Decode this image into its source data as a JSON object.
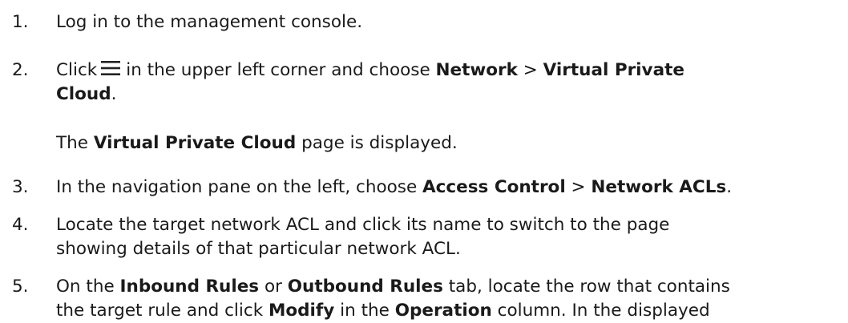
{
  "steps": [
    {
      "number": "1.",
      "text": "Log in to the management console."
    },
    {
      "number": "2.",
      "click": "Click",
      "icon": "menu-icon",
      "mid": "in the upper left corner and choose",
      "b1": "Network",
      "sep": ">",
      "b2": "Virtual Private",
      "b3": "Cloud",
      "end": "."
    },
    {
      "result_prefix": "The",
      "result_bold": "Virtual Private Cloud",
      "result_suffix": "page is displayed."
    },
    {
      "number": "3.",
      "pre": "In the navigation pane on the left, choose",
      "b1": "Access Control",
      "sep": ">",
      "b2": "Network ACLs",
      "end": "."
    },
    {
      "number": "4.",
      "line1": "Locate the target network ACL and click its name to switch to the page",
      "line2": "showing details of that particular network ACL."
    },
    {
      "number": "5.",
      "pre": "On the",
      "b1": "Inbound Rules",
      "or": "or",
      "b2": "Outbound Rules",
      "mid": "tab, locate the row that contains",
      "line2_pre": "the target rule and click",
      "b3": "Modify",
      "in_the": "in the",
      "b4": "Operation",
      "line2_end": "column. In the displayed"
    }
  ]
}
